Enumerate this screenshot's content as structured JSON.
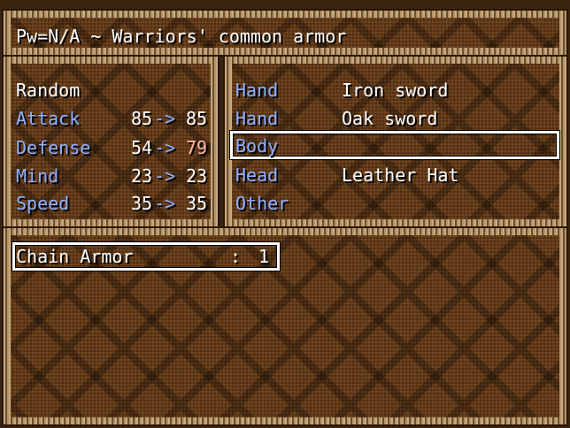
{
  "header": {
    "description": "Pw=N/A ~ Warriors' common armor"
  },
  "stats": {
    "character_name": "Random",
    "rows": [
      {
        "label": "Attack",
        "current": "85",
        "arrow": "->",
        "new": "85"
      },
      {
        "label": "Defense",
        "current": "54",
        "arrow": "->",
        "new": "79"
      },
      {
        "label": "Mind",
        "current": "23",
        "arrow": "->",
        "new": "23"
      },
      {
        "label": "Speed",
        "current": "35",
        "arrow": "->",
        "new": "35"
      }
    ]
  },
  "equipment": {
    "slots": [
      {
        "slot": "Hand",
        "item": "Iron sword"
      },
      {
        "slot": "Hand",
        "item": "Oak sword"
      },
      {
        "slot": "Body",
        "item": ""
      },
      {
        "slot": "Head",
        "item": "Leather Hat"
      },
      {
        "slot": "Other",
        "item": ""
      }
    ],
    "selected_index": 2
  },
  "inventory": {
    "items": [
      {
        "name": "Chain Armor",
        "separator": ":",
        "count": "1"
      }
    ]
  },
  "colors": {
    "label_text": "#8fb0ff",
    "stat_increase": "#ffb8a0",
    "text": "#ffffff",
    "frame": "#b59468",
    "window_bg": "#5a3414"
  }
}
